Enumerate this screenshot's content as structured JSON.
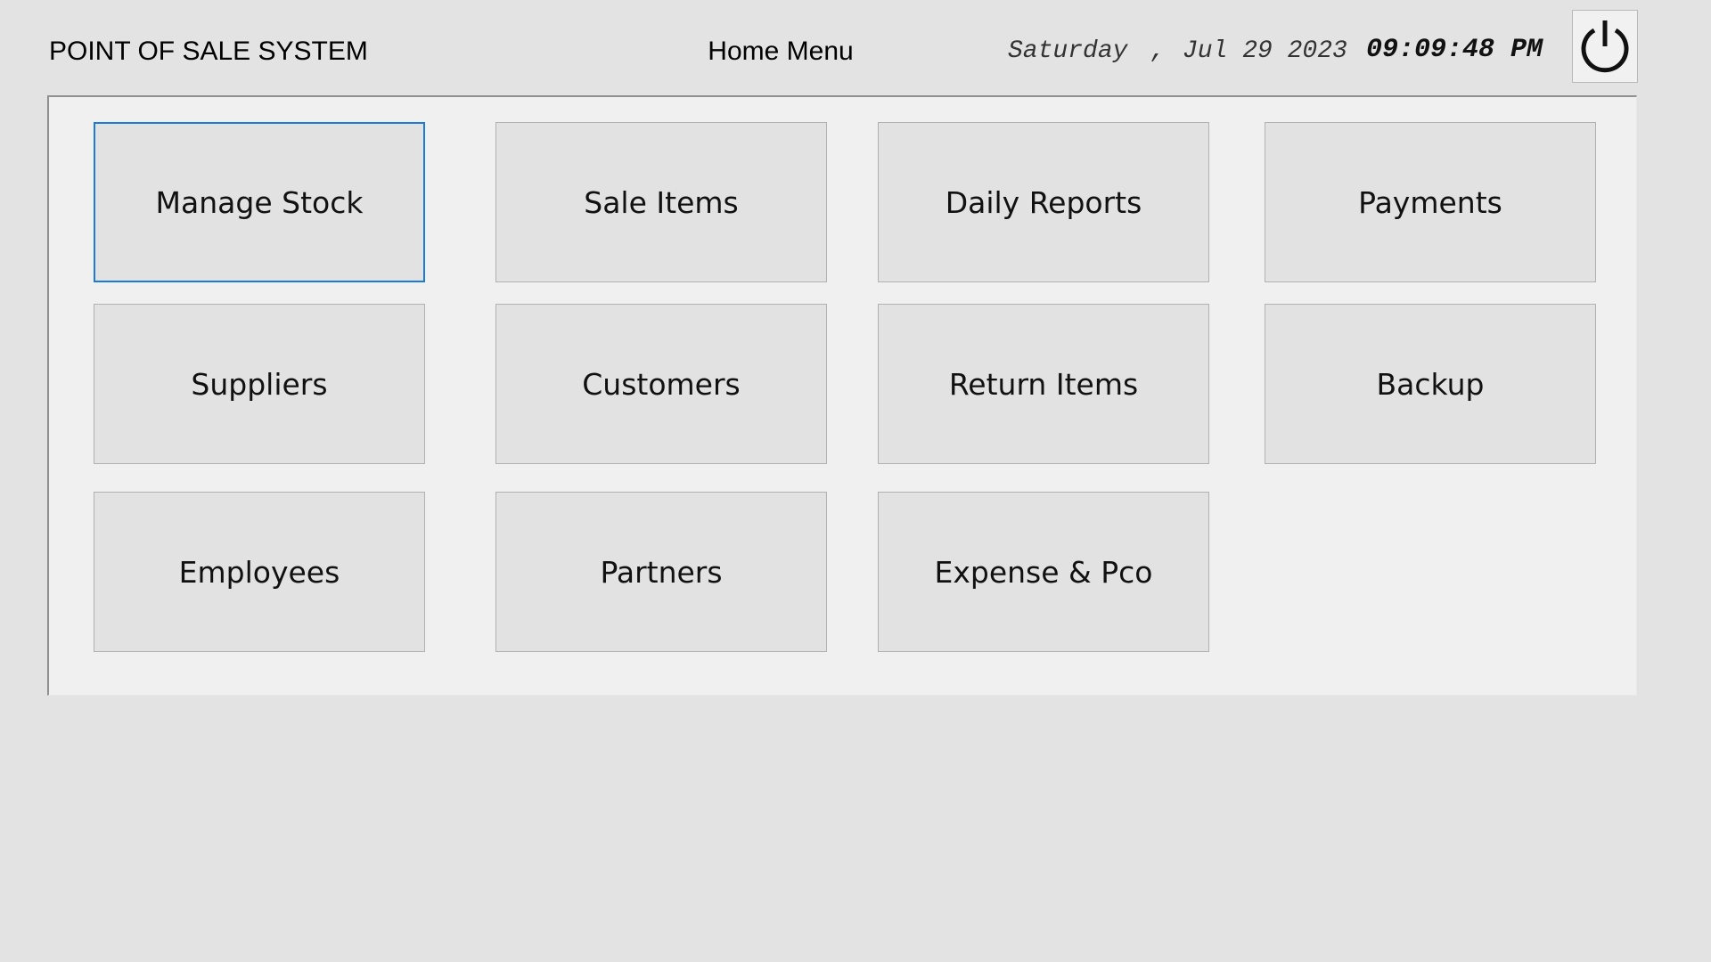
{
  "header": {
    "app_title": "POINT OF SALE SYSTEM",
    "page_title": "Home Menu",
    "day": "Saturday",
    "separator": ",",
    "date": "Jul 29 2023",
    "time": "09:09:48 PM",
    "power_icon": "power-icon"
  },
  "menu": {
    "buttons": [
      {
        "label": "Manage Stock",
        "focused": true
      },
      {
        "label": "Sale Items"
      },
      {
        "label": "Daily Reports"
      },
      {
        "label": "Payments"
      },
      {
        "label": "Suppliers"
      },
      {
        "label": "Customers"
      },
      {
        "label": "Return Items"
      },
      {
        "label": "Backup"
      },
      {
        "label": "Employees"
      },
      {
        "label": "Partners"
      },
      {
        "label": "Expense & Pco"
      }
    ]
  },
  "colors": {
    "background": "#e3e3e3",
    "panel": "#f0f0f0",
    "button": "#e2e2e2",
    "focus_accent": "#1a7ad6"
  }
}
